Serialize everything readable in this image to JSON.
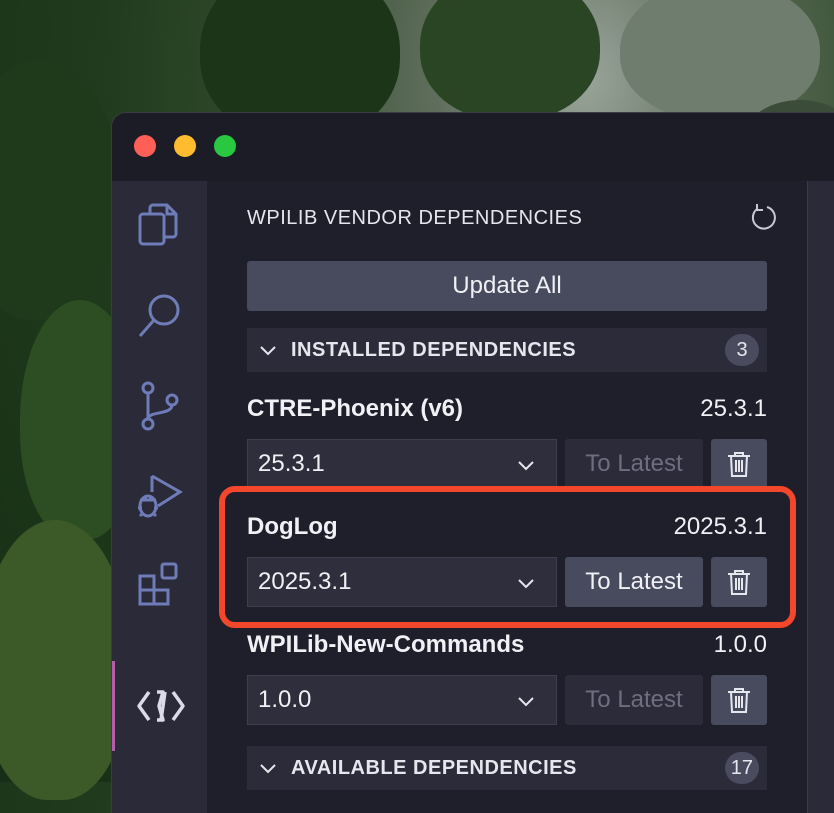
{
  "window": {
    "traffic_colors": {
      "close": "#ff5f57",
      "minimize": "#febc2e",
      "maximize": "#28c840"
    }
  },
  "activitybar": {
    "items": [
      {
        "icon": "explorer-icon"
      },
      {
        "icon": "search-icon"
      },
      {
        "icon": "source-control-icon"
      },
      {
        "icon": "run-debug-icon"
      },
      {
        "icon": "extensions-icon"
      },
      {
        "icon": "wpilib-vendor-icon",
        "active": true
      }
    ]
  },
  "sidebar": {
    "title": "WPILIB VENDOR DEPENDENCIES",
    "refresh_icon": "refresh-icon",
    "update_all_label": "Update All",
    "installed": {
      "label": "INSTALLED DEPENDENCIES",
      "count": "3",
      "items": [
        {
          "name": "CTRE-Phoenix (v6)",
          "version": "25.3.1",
          "selected": "25.3.1",
          "to_latest": "To Latest",
          "to_latest_enabled": false
        },
        {
          "name": "DogLog",
          "version": "2025.3.1",
          "selected": "2025.3.1",
          "to_latest": "To Latest",
          "to_latest_enabled": true
        },
        {
          "name": "WPILib-New-Commands",
          "version": "1.0.0",
          "selected": "1.0.0",
          "to_latest": "To Latest",
          "to_latest_enabled": false
        }
      ]
    },
    "available": {
      "label": "AVAILABLE DEPENDENCIES",
      "count": "17"
    }
  },
  "highlight_color": "#f2472a"
}
